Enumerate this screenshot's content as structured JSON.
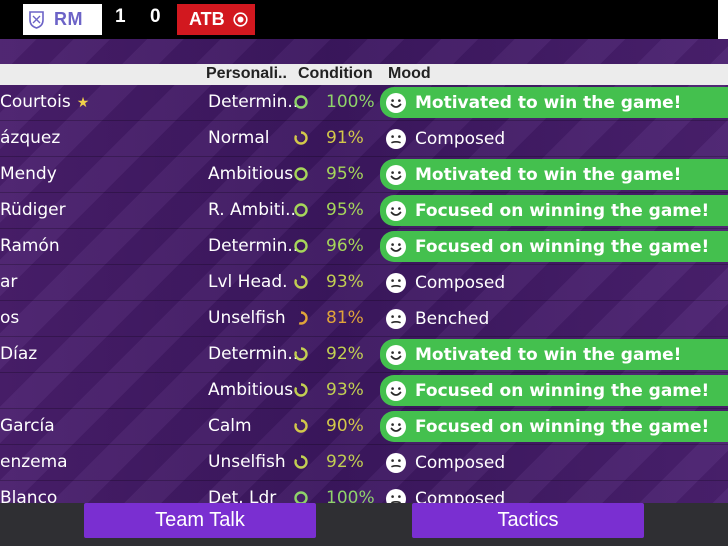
{
  "match": {
    "home": {
      "abbr": "RM"
    },
    "away": {
      "abbr": "ATB"
    },
    "home_score": "1",
    "away_score": "0",
    "colors": {
      "home_bg": "#ffffff",
      "home_text": "#6c63c7",
      "away_bg": "#d2181f"
    }
  },
  "table": {
    "headers": {
      "personality": "Personali..",
      "condition": "Condition",
      "mood": "Mood"
    },
    "rows": [
      {
        "name": "Courtois",
        "star": "★",
        "personality": "Determin..",
        "condition": "100%",
        "cond_color": "#8fd36a",
        "ring": "full",
        "mood": "Motivated to win the game!",
        "highlight": true,
        "face": "happy"
      },
      {
        "name": "ázquez",
        "star": "",
        "personality": "Normal",
        "condition": "91%",
        "cond_color": "#d3c84a",
        "ring": "high",
        "mood": "Composed",
        "highlight": false,
        "face": "neutral"
      },
      {
        "name": "Mendy",
        "star": "",
        "personality": "Ambitious",
        "condition": "95%",
        "cond_color": "#a6d65a",
        "ring": "full",
        "mood": "Motivated to win the game!",
        "highlight": true,
        "face": "happy"
      },
      {
        "name": "Rüdiger",
        "star": "",
        "personality": "R. Ambiti..",
        "condition": "95%",
        "cond_color": "#a6d65a",
        "ring": "full",
        "mood": "Focused on winning the game!",
        "highlight": true,
        "face": "happy"
      },
      {
        "name": "Ramón",
        "star": "",
        "personality": "Determin..",
        "condition": "96%",
        "cond_color": "#a6d65a",
        "ring": "full",
        "mood": "Focused on winning the game!",
        "highlight": true,
        "face": "happy"
      },
      {
        "name": "ar",
        "star": "",
        "personality": "Lvl Head.",
        "condition": "93%",
        "cond_color": "#c2cf52",
        "ring": "high",
        "mood": "Composed",
        "highlight": false,
        "face": "neutral"
      },
      {
        "name": "os",
        "star": "",
        "personality": "Unselfish",
        "condition": "81%",
        "cond_color": "#e0a43a",
        "ring": "low",
        "mood": "Benched",
        "highlight": false,
        "face": "neutral"
      },
      {
        "name": "Díaz",
        "star": "",
        "personality": "Determin..",
        "condition": "92%",
        "cond_color": "#c2cf52",
        "ring": "high",
        "mood": "Motivated to win the game!",
        "highlight": true,
        "face": "happy"
      },
      {
        "name": "",
        "star": "",
        "personality": "Ambitious",
        "condition": "93%",
        "cond_color": "#c2cf52",
        "ring": "high",
        "mood": "Focused on winning the game!",
        "highlight": true,
        "face": "happy"
      },
      {
        "name": "García",
        "star": "",
        "personality": "Calm",
        "condition": "90%",
        "cond_color": "#d3c84a",
        "ring": "high",
        "mood": "Focused on winning the game!",
        "highlight": true,
        "face": "happy"
      },
      {
        "name": "enzema",
        "star": "",
        "personality": "Unselfish",
        "condition": "92%",
        "cond_color": "#c2cf52",
        "ring": "high",
        "mood": "Composed",
        "highlight": false,
        "face": "neutral"
      },
      {
        "name": "Blanco",
        "star": "",
        "personality": "Det. Ldr",
        "condition": "100%",
        "cond_color": "#8fd36a",
        "ring": "full",
        "mood": "Composed",
        "highlight": false,
        "face": "neutral"
      }
    ]
  },
  "footer": {
    "team_talk": "Team Talk",
    "tactics": "Tactics"
  }
}
